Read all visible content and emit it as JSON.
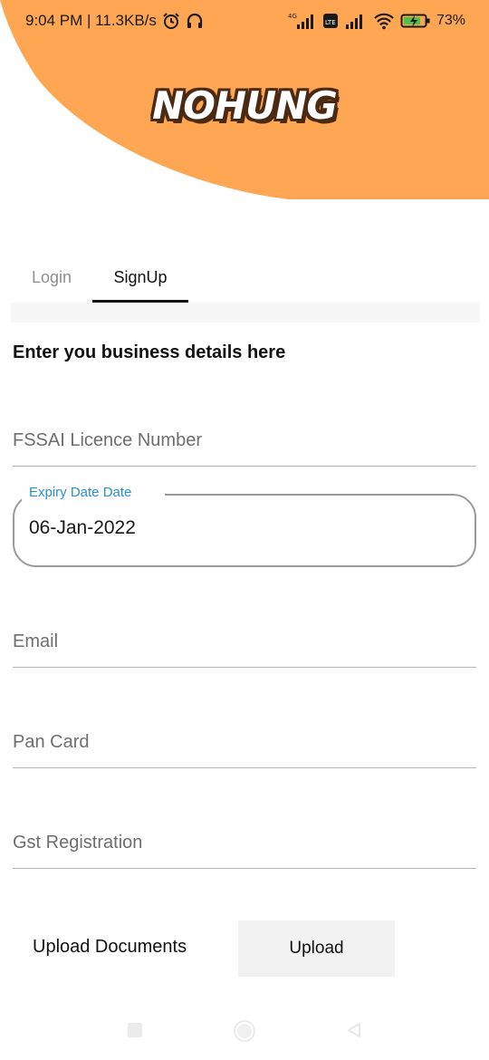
{
  "status_bar": {
    "time_info": "9:04 PM | 11.3KB/s",
    "network_label": "4G",
    "volte_label": "LTE",
    "battery_percent": "73%"
  },
  "brand": {
    "logo_text": "NOHUNG",
    "accent_color": "#ffa653"
  },
  "tabs": [
    {
      "label": "Login",
      "active": false
    },
    {
      "label": "SignUp",
      "active": true
    }
  ],
  "form": {
    "section_title": "Enter you business details here",
    "fssai": {
      "placeholder": "FSSAI Licence Number",
      "value": ""
    },
    "expiry_date": {
      "label": "Expiry Date Date",
      "value": "06-Jan-2022"
    },
    "email": {
      "placeholder": "Email",
      "value": ""
    },
    "pan_card": {
      "placeholder": "Pan Card",
      "value": ""
    },
    "gst": {
      "placeholder": "Gst Registration",
      "value": ""
    },
    "upload_label": "Upload Documents",
    "upload_button": "Upload"
  },
  "nav_bar": {
    "icons": [
      "recent-apps-icon",
      "home-icon",
      "back-icon"
    ]
  }
}
